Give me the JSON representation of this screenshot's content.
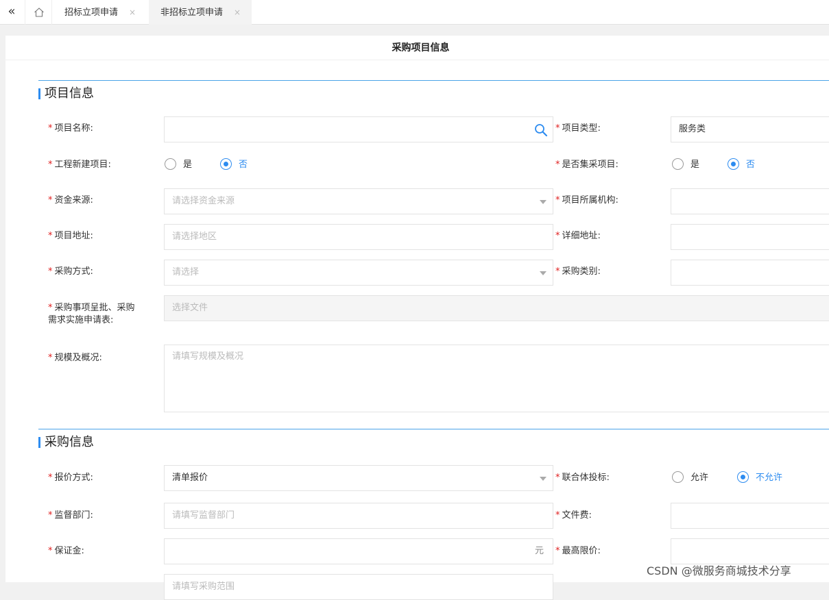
{
  "tabs": {
    "back_glyph": "«",
    "items": [
      {
        "label": "招标立项申请",
        "close": "×"
      },
      {
        "label": "非招标立项申请",
        "close": "×"
      }
    ]
  },
  "panel": {
    "title": "采购项目信息"
  },
  "section1": {
    "title": "项目信息",
    "project_name": {
      "label": "项目名称:",
      "value": ""
    },
    "project_type": {
      "label": "项目类型:",
      "value": "服务类"
    },
    "new_construction": {
      "label": "工程新建项目:",
      "options": [
        "是",
        "否"
      ],
      "selected": "否"
    },
    "centralized": {
      "label": "是否集采项目:",
      "options": [
        "是",
        "否"
      ],
      "selected": "否"
    },
    "fund_source": {
      "label": "资金来源:",
      "placeholder": "请选择资金来源"
    },
    "org": {
      "label": "项目所属机构:",
      "value": ""
    },
    "address": {
      "label": "项目地址:",
      "placeholder": "请选择地区"
    },
    "detail_address": {
      "label": "详细地址:",
      "value": ""
    },
    "method": {
      "label": "采购方式:",
      "placeholder": "请选择"
    },
    "category": {
      "label": "采购类别:",
      "value": ""
    },
    "attachment": {
      "label_line1": "采购事项呈批、采购",
      "label_line2": "需求实施申请表:",
      "placeholder": "选择文件"
    },
    "scale": {
      "label": "规模及概况:",
      "placeholder": "请填写规模及概况"
    }
  },
  "section2": {
    "title": "采购信息",
    "quote": {
      "label": "报价方式:",
      "value": "清单报价"
    },
    "consortium": {
      "label": "联合体投标:",
      "options": [
        "允许",
        "不允许"
      ],
      "selected": "不允许"
    },
    "supervisor": {
      "label": "监督部门:",
      "placeholder": "请填写监督部门"
    },
    "doc_fee": {
      "label": "文件费:",
      "value": ""
    },
    "deposit": {
      "label": "保证金:",
      "unit": "元"
    },
    "max_price": {
      "label": "最高限价:",
      "value": ""
    },
    "partial_placeholder": "请填写采购范围"
  },
  "watermark": "CSDN @微服务商城技术分享",
  "colors": {
    "accent": "#2d8cf0",
    "required": "#e02020",
    "section_line": "#4aa3e8"
  },
  "icons": [
    "double-chevron-left-icon",
    "home-icon",
    "close-icon",
    "search-icon",
    "caret-down-icon"
  ]
}
